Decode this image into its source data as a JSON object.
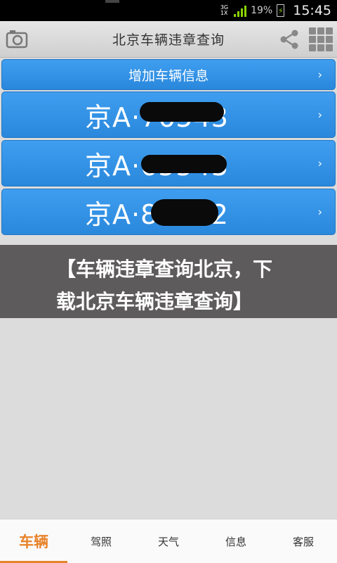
{
  "status_bar": {
    "network_top": "3G",
    "network_bottom": "1X",
    "battery_percent": "19%",
    "time": "15:45"
  },
  "header": {
    "title": "北京车辆违章查询",
    "camera_icon": "camera-icon",
    "share_icon": "share-icon",
    "grid_icon": "grid-menu-icon"
  },
  "list": {
    "add_label": "增加车辆信息",
    "plates": [
      {
        "text": "京A·76543"
      },
      {
        "text": "京A·65543"
      },
      {
        "text": "京A·85552"
      }
    ],
    "chevron": "›"
  },
  "banner": {
    "line1": "【车辆违章查询北京，下",
    "line2": "载北京车辆违章查询】"
  },
  "tabs": [
    {
      "label": "车辆",
      "active": true
    },
    {
      "label": "驾照",
      "active": false
    },
    {
      "label": "天气",
      "active": false
    },
    {
      "label": "信息",
      "active": false
    },
    {
      "label": "客服",
      "active": false
    }
  ],
  "colors": {
    "accent": "#e8832a",
    "row_blue": "#3394e8",
    "banner_bg": "#5e5b5c"
  }
}
